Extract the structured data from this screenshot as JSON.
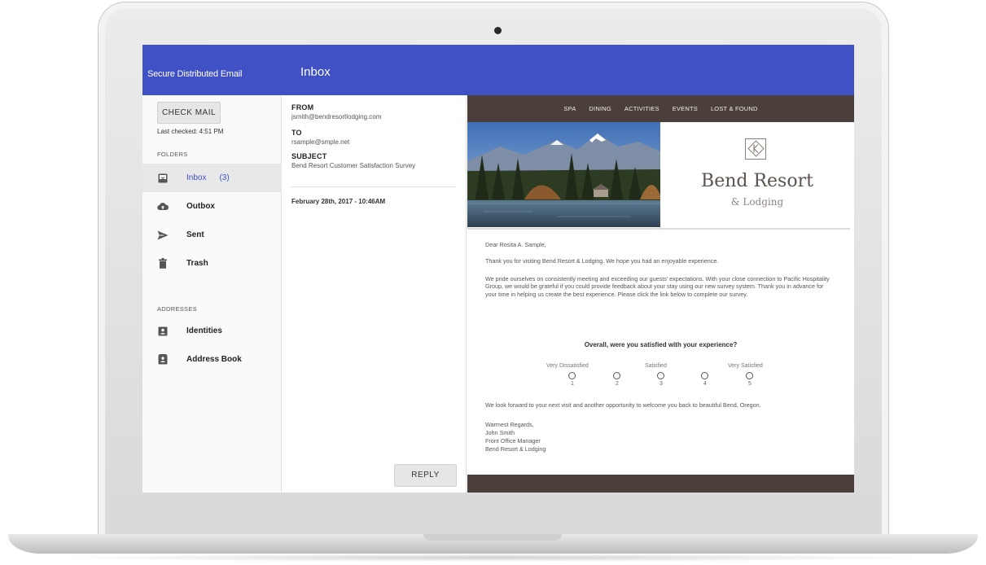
{
  "app": {
    "title": "Secure Distributed Email",
    "view_title": "Inbox"
  },
  "sidebar": {
    "check_mail_label": "CHECK MAIL",
    "last_checked": "Last checked: 4:51 PM",
    "folders_label": "FOLDERS",
    "folders": [
      {
        "label": "Inbox",
        "count": "(3)",
        "icon": "inbox-icon",
        "active": true
      },
      {
        "label": "Outbox",
        "icon": "cloud-upload-icon"
      },
      {
        "label": "Sent",
        "icon": "send-icon"
      },
      {
        "label": "Trash",
        "icon": "trash-icon"
      }
    ],
    "addresses_label": "ADDRESSES",
    "addresses": [
      {
        "label": "Identities",
        "icon": "identity-card-icon"
      },
      {
        "label": "Address Book",
        "icon": "address-book-icon"
      }
    ]
  },
  "message_meta": {
    "from_label": "FROM",
    "from_value": "jsmith@bendresortlodging.com",
    "to_label": "TO",
    "to_value": "rsample@smple.net",
    "subject_label": "SUBJECT",
    "subject_value": "Bend Resort Customer Satisfaction Survey",
    "date": "February 28th, 2017 - 10:46AM",
    "reply_label": "REPLY"
  },
  "email": {
    "nav": [
      "SPA",
      "DINING",
      "ACTIVITIES",
      "EVENTS",
      "LOST & FOUND"
    ],
    "brand_name": "Bend Resort",
    "brand_sub": "& Lodging",
    "greeting": "Dear Rosita A. Sample,",
    "para1": "Thank you for visiting Bend Resort & Lodging. We hope you had an enjoyable experience.",
    "para2": "We pride ourselves on consistently meeting and exceeding our guests' expectations. With your close connection to Pacific Hospitality Group, we would be grateful if you could provide feedback about your stay using our new survey system. Thank you in advance for your time in helping us create the best experience. Please click the link below to complete our survey.",
    "survey_question": "Overall, were you satisfied with your experience?",
    "scale_labels": {
      "low": "Very Dissatisfied",
      "mid": "Satisfied",
      "high": "Very Satisfied"
    },
    "scale_numbers": [
      "1",
      "2",
      "3",
      "4",
      "5"
    ],
    "closing_para": "We look forward to your next visit and another opportunity to welcome you back to beautiful Bend, Oregon.",
    "signoff": "Warmest Regards,",
    "signer_name": "John Smith",
    "signer_title": "Front Office Manager",
    "signer_org": "Bend Resort & Lodging"
  },
  "colors": {
    "topbar": "#3f51c4",
    "email_nav": "#4a3f3b",
    "active_folder_text": "#3f51c4"
  }
}
